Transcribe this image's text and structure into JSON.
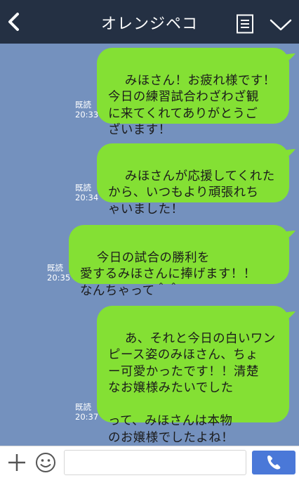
{
  "header": {
    "title": "オレンジペコ",
    "back_icon": "back-chevron-icon",
    "menu_icon": "document-menu-icon",
    "expand_icon": "chevron-down-icon",
    "background": "#243043"
  },
  "chat": {
    "background": "#7491be",
    "bubble_color": "#84e034",
    "messages": [
      {
        "text": "みほさん！お疲れ様です！\n今日の練習試合わざわざ観\nに来てくれてありがとうご\nざいます！",
        "read_label": "既読",
        "time": "20:33"
      },
      {
        "text": "みほさんが応援してくれた\nから、いつもより頑張れち\nゃいました！",
        "read_label": "既読",
        "time": "20:34"
      },
      {
        "text": "今日の試合の勝利を\n愛するみほさんに捧げます！！\nなんちゃって＾＾",
        "read_label": "既読",
        "time": "20:35"
      },
      {
        "text": "あ、それと今日の白いワン\nピース姿のみほさん、ちょ\nー可愛かったです！！清楚\nなお嬢様みたいでした\n\nって、みほさんは本物\nのお嬢様でしたよね！",
        "read_label": "既読",
        "time": "20:37"
      }
    ]
  },
  "footer": {
    "plus_icon": "plus-icon",
    "sticker_icon": "smile-icon",
    "input_value": "",
    "send_icon": "phone-icon",
    "send_color": "#4a78d8"
  }
}
